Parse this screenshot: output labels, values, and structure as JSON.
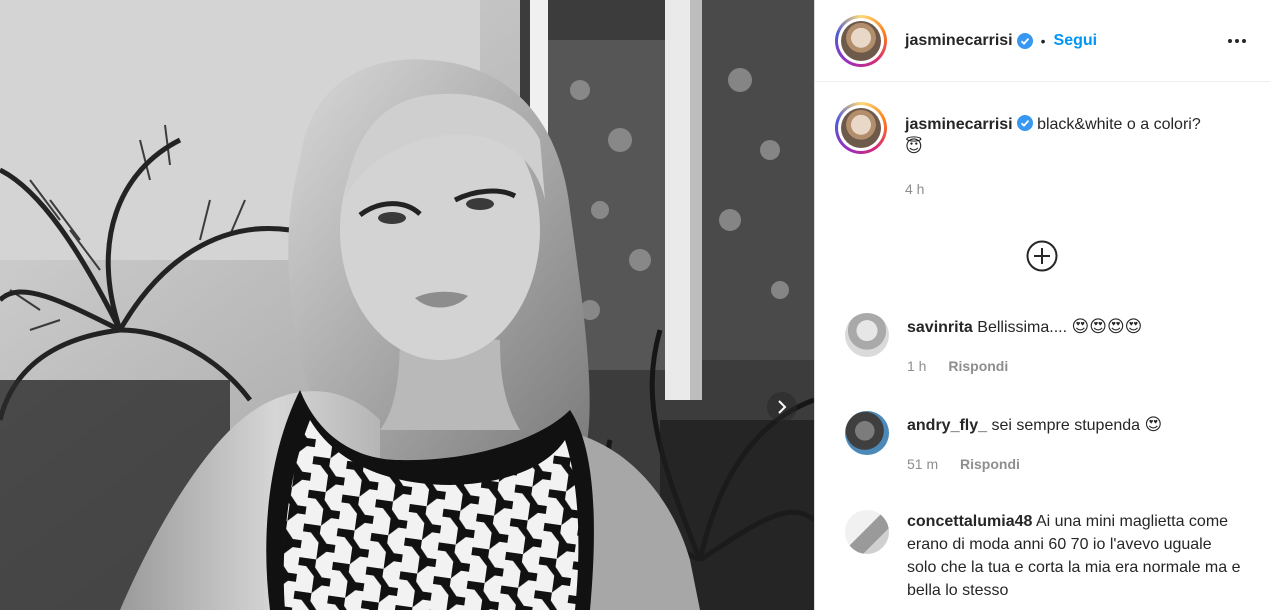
{
  "post": {
    "username": "jasminecarrisi",
    "follow_label": "Segui",
    "separator": "•",
    "caption_text": "black&white o a colori?",
    "caption_emoji": "😇",
    "caption_time": "4 h"
  },
  "comments": [
    {
      "username": "savinrita",
      "text": "Bellissima....",
      "emoji": "😍😍😍😍",
      "time": "1 h",
      "reply_label": "Rispondi"
    },
    {
      "username": "andry_fly_",
      "text": "sei sempre stupenda",
      "emoji": "😍",
      "time": "51 m",
      "reply_label": "Rispondi"
    },
    {
      "username": "concettalumia48",
      "text": "Ai una mini maglietta come erano di moda anni 60 70 io l'avevo uguale solo che la tua e corta la mia era normale ma e bella lo stesso"
    }
  ],
  "icons": {
    "verified": "verified-badge-icon",
    "more": "more-options-icon",
    "load_more": "plus-circle-icon",
    "next": "chevron-right-icon"
  },
  "colors": {
    "accent": "#0095f6",
    "verified": "#3897f0",
    "muted": "#8e8e8e",
    "text": "#262626"
  }
}
